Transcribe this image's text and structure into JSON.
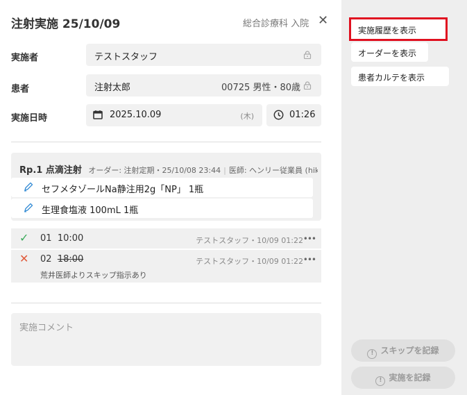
{
  "header": {
    "title": "注射実施 25/10/09",
    "department": "総合診療科 入院",
    "close_glyph": "✕"
  },
  "form": {
    "executor": {
      "label": "実施者",
      "value": "テストスタッフ"
    },
    "patient": {
      "label": "患者",
      "name": "注射太郎",
      "info": "00725 男性・80歳"
    },
    "datetime": {
      "label": "実施日時",
      "date": "2025.10.09",
      "weekday": "(木)",
      "time": "01:26"
    }
  },
  "prescription": {
    "rp": "Rp.1 点滴注射",
    "order": "オーダー: 注射定期・25/10/08 23:44",
    "doctor": "医師: ヘンリー従業員 (hikari.c",
    "drugs": [
      {
        "name": "セフメタゾールNa静注用2g「NP」 1瓶"
      },
      {
        "name": "生理食塩液 100mL 1瓶"
      }
    ]
  },
  "executions": [
    {
      "status": "done",
      "mark": "✓",
      "number": "01",
      "time": "10:00",
      "by": "テストスタッフ・10/09 01:22",
      "more": "•••"
    },
    {
      "status": "skipped",
      "mark": "✕",
      "number": "02",
      "time": "18:00",
      "by": "テストスタッフ・10/09 01:22",
      "more": "•••",
      "note": "荒井医師よりスキップ指示あり"
    }
  ],
  "comment": {
    "placeholder": "実施コメント"
  },
  "side": {
    "history_button": "実施履歴を表示",
    "order_button": "オーダーを表示",
    "chart_button": "患者カルテを表示",
    "skip_button": "スキップを記録",
    "execute_button": "実施を記録",
    "warn_glyph": "!"
  },
  "colors": {
    "check": "#3aaa5a",
    "cross": "#e05a3a",
    "pen": "#3a8fd6",
    "highlight": "#e01020"
  }
}
